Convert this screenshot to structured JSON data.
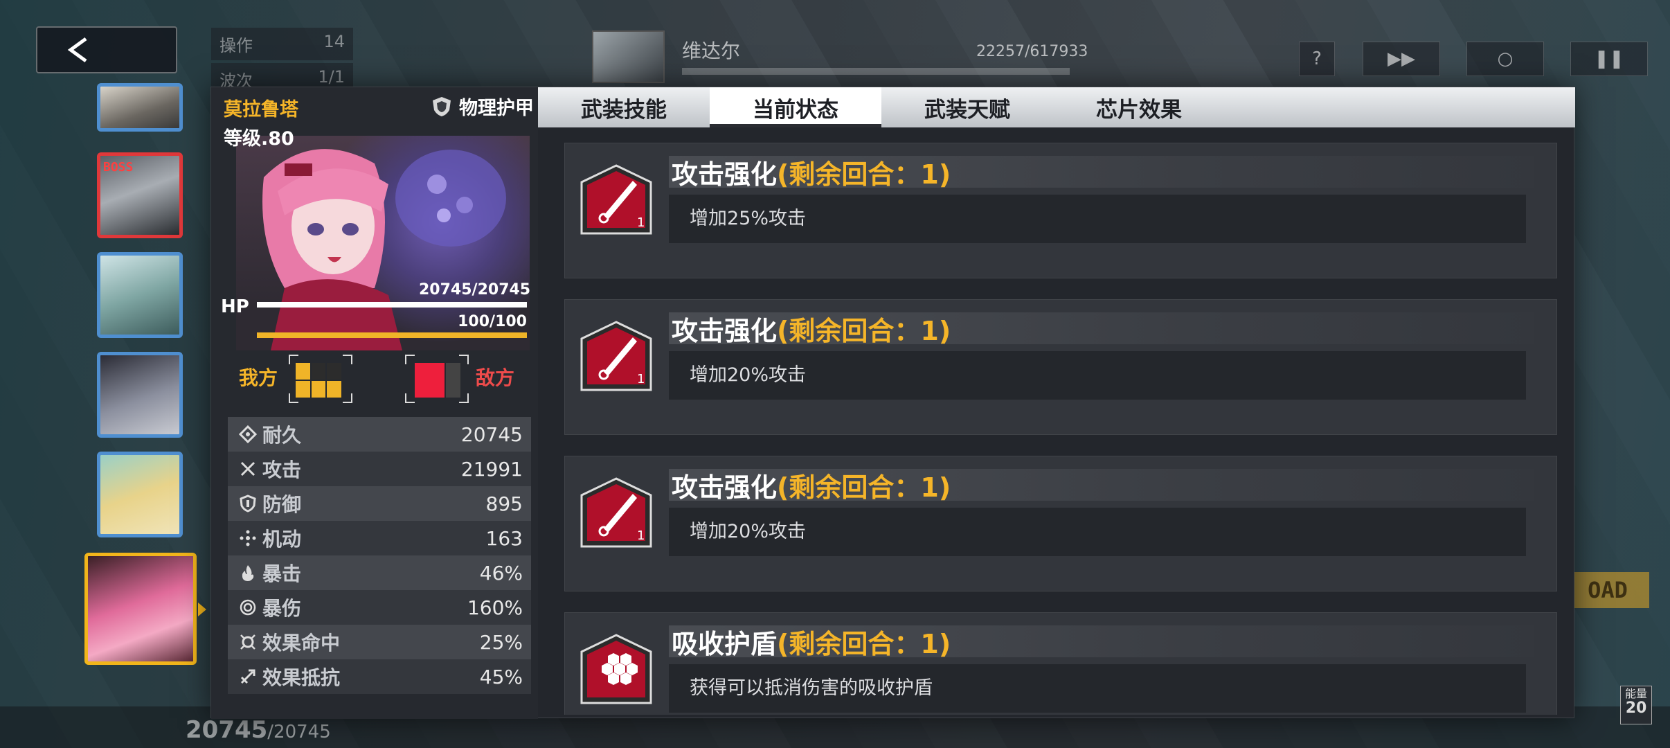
{
  "top": {
    "op_label": "操作",
    "op_value": "14",
    "wave_label": "波次",
    "wave_value": "1/1",
    "boss_name": "维达尔",
    "boss_hp": "22257/617933"
  },
  "bottom": {
    "hp_current": "20745",
    "hp_max": "/20745",
    "energy_label": "能量",
    "energy_value": "20",
    "auto_label": "OAD"
  },
  "roster": [
    {
      "id": "r1",
      "boss": false
    },
    {
      "id": "r2",
      "boss": true,
      "boss_label": "BOSS"
    },
    {
      "id": "r3",
      "boss": false
    },
    {
      "id": "r4",
      "boss": false
    },
    {
      "id": "r5",
      "boss": false
    },
    {
      "id": "r6",
      "boss": false,
      "selected": true
    }
  ],
  "character": {
    "name": "莫拉鲁塔",
    "level": "等级.80",
    "armor_type": "物理护甲",
    "hp_label": "HP",
    "hp_value": "20745/20745",
    "hp_fraction": 1.0,
    "energy_value": "100/100",
    "energy_fraction": 1.0,
    "ally_label": "我方",
    "enemy_label": "敌方"
  },
  "stats": [
    {
      "icon": "durability-icon",
      "label": "耐久",
      "value": "20745"
    },
    {
      "icon": "attack-icon",
      "label": "攻击",
      "value": "21991"
    },
    {
      "icon": "defense-icon",
      "label": "防御",
      "value": "895"
    },
    {
      "icon": "mobility-icon",
      "label": "机动",
      "value": "163"
    },
    {
      "icon": "crit-icon",
      "label": "暴击",
      "value": "46%"
    },
    {
      "icon": "crit-damage-icon",
      "label": "暴伤",
      "value": "160%"
    },
    {
      "icon": "effect-hit-icon",
      "label": "效果命中",
      "value": "25%"
    },
    {
      "icon": "effect-resist-icon",
      "label": "效果抵抗",
      "value": "45%"
    }
  ],
  "tabs": [
    {
      "label": "武装技能",
      "active": false
    },
    {
      "label": "当前状态",
      "active": true
    },
    {
      "label": "武装天赋",
      "active": false
    },
    {
      "label": "芯片效果",
      "active": false
    }
  ],
  "effects": [
    {
      "icon": "attack-boost-icon",
      "stack": "1",
      "title": "攻击强化",
      "remaining": "(剩余回合：1)",
      "desc": "增加25%攻击"
    },
    {
      "icon": "attack-boost-icon",
      "stack": "1",
      "title": "攻击强化",
      "remaining": "(剩余回合：1)",
      "desc": "增加20%攻击"
    },
    {
      "icon": "attack-boost-icon",
      "stack": "1",
      "title": "攻击强化",
      "remaining": "(剩余回合：1)",
      "desc": "增加20%攻击"
    },
    {
      "icon": "shield-hex-icon",
      "stack": "",
      "title": "吸收护盾",
      "remaining": "(剩余回合：1)",
      "desc": "获得可以抵消伤害的吸收护盾"
    }
  ],
  "colors": {
    "accent": "#f5b529",
    "enemy": "#ee4b4b",
    "boss_border": "#e0383a",
    "ally_border": "#4f8fd0",
    "buff_red": "#c8102e"
  }
}
